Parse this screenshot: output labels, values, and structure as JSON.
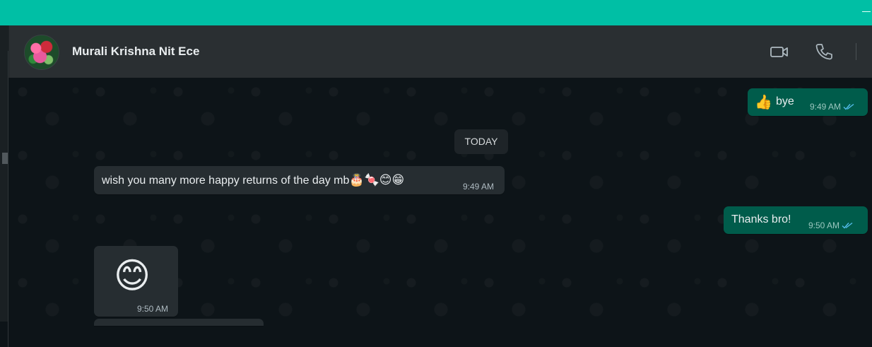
{
  "chat": {
    "contact_name": "Murali Krishna Nit Ece"
  },
  "messages": {
    "m1": {
      "text": "bye",
      "time": "9:49 AM",
      "emoji": "👍"
    },
    "date_separator": "TODAY",
    "m2": {
      "text": "wish you many more happy returns of the day mb",
      "emoji": "🎂🍬😊😁",
      "time": "9:49 AM"
    },
    "m3": {
      "text": "Thanks bro!",
      "time": "9:50 AM"
    },
    "m4": {
      "emoji": "😊",
      "time": "9:50 AM"
    }
  },
  "colors": {
    "accent_bar": "#00bfa5",
    "header_bg": "#2a2f32",
    "outgoing_bubble": "#005c4b",
    "incoming_bubble": "#262d31",
    "read_tick": "#53bdeb"
  },
  "icons": {
    "video_call": "video-camera-icon",
    "voice_call": "phone-icon",
    "read_receipt": "double-check-icon"
  }
}
